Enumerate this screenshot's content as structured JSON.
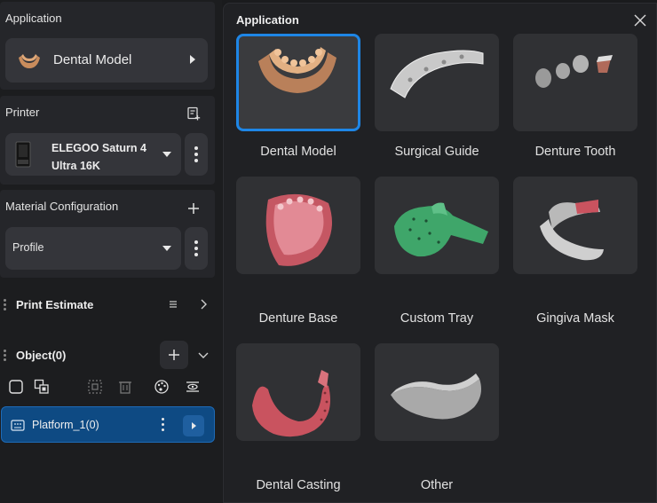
{
  "sidebar": {
    "application": {
      "title": "Application",
      "selected": "Dental Model"
    },
    "printer": {
      "title": "Printer",
      "name_line1": "ELEGOO Saturn 4",
      "name_line2": "Ultra 16K"
    },
    "material": {
      "title": "Material Configuration",
      "profile": "Profile"
    },
    "print_estimate": {
      "title": "Print Estimate"
    },
    "objects": {
      "title": "Object(0)"
    },
    "platform": {
      "label": "Platform_1(0)"
    }
  },
  "dialog": {
    "title": "Application",
    "items": [
      {
        "label": "Dental Model",
        "selected": true
      },
      {
        "label": "Surgical Guide",
        "selected": false
      },
      {
        "label": "Denture Tooth",
        "selected": false
      },
      {
        "label": "Denture Base",
        "selected": false
      },
      {
        "label": "Custom Tray",
        "selected": false
      },
      {
        "label": "Gingiva Mask",
        "selected": false
      },
      {
        "label": "Dental Casting",
        "selected": false
      },
      {
        "label": "Other",
        "selected": false
      }
    ]
  },
  "colors": {
    "accent": "#1e86e6",
    "selected_row": "#0e4a83",
    "model_tan": "#c98c5c",
    "model_pink": "#d96f7a",
    "tray_green": "#3fa66a"
  },
  "icons": [
    "dental-model-thumb-icon",
    "printer-add-icon",
    "printer-device-icon",
    "plus-icon",
    "list-icon",
    "chevron-right-icon",
    "chevron-down-icon",
    "checkbox-icon",
    "select-all-icon",
    "frame-icon",
    "trash-icon",
    "palette-icon",
    "visibility-icon",
    "platform-icon",
    "close-icon"
  ]
}
